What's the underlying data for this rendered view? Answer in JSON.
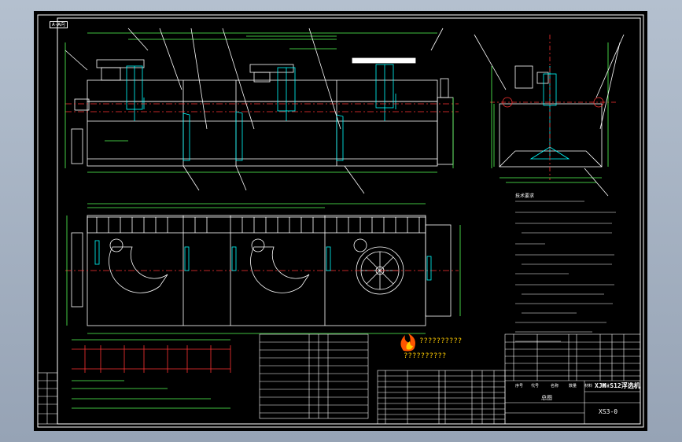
{
  "drawing": {
    "title_name": "XJM-S12浮选机",
    "drawing_number": "XS3-0",
    "view_label": "A-A向",
    "sheet_label": "总图",
    "logo_text_line1": "??????????",
    "logo_text_line2": "??????????",
    "header_cells": [
      "序号",
      "代号",
      "名称",
      "数量",
      "材料",
      "备注"
    ],
    "tech_requirements_title": "技术要求"
  },
  "colors": {
    "background": "#000000",
    "outline": "#ffffff",
    "dimension": "#55ff55",
    "centerline": "#ff3333",
    "part": "#00ffff",
    "accent": "#ffcc00",
    "label_tag": "#ffff55"
  }
}
